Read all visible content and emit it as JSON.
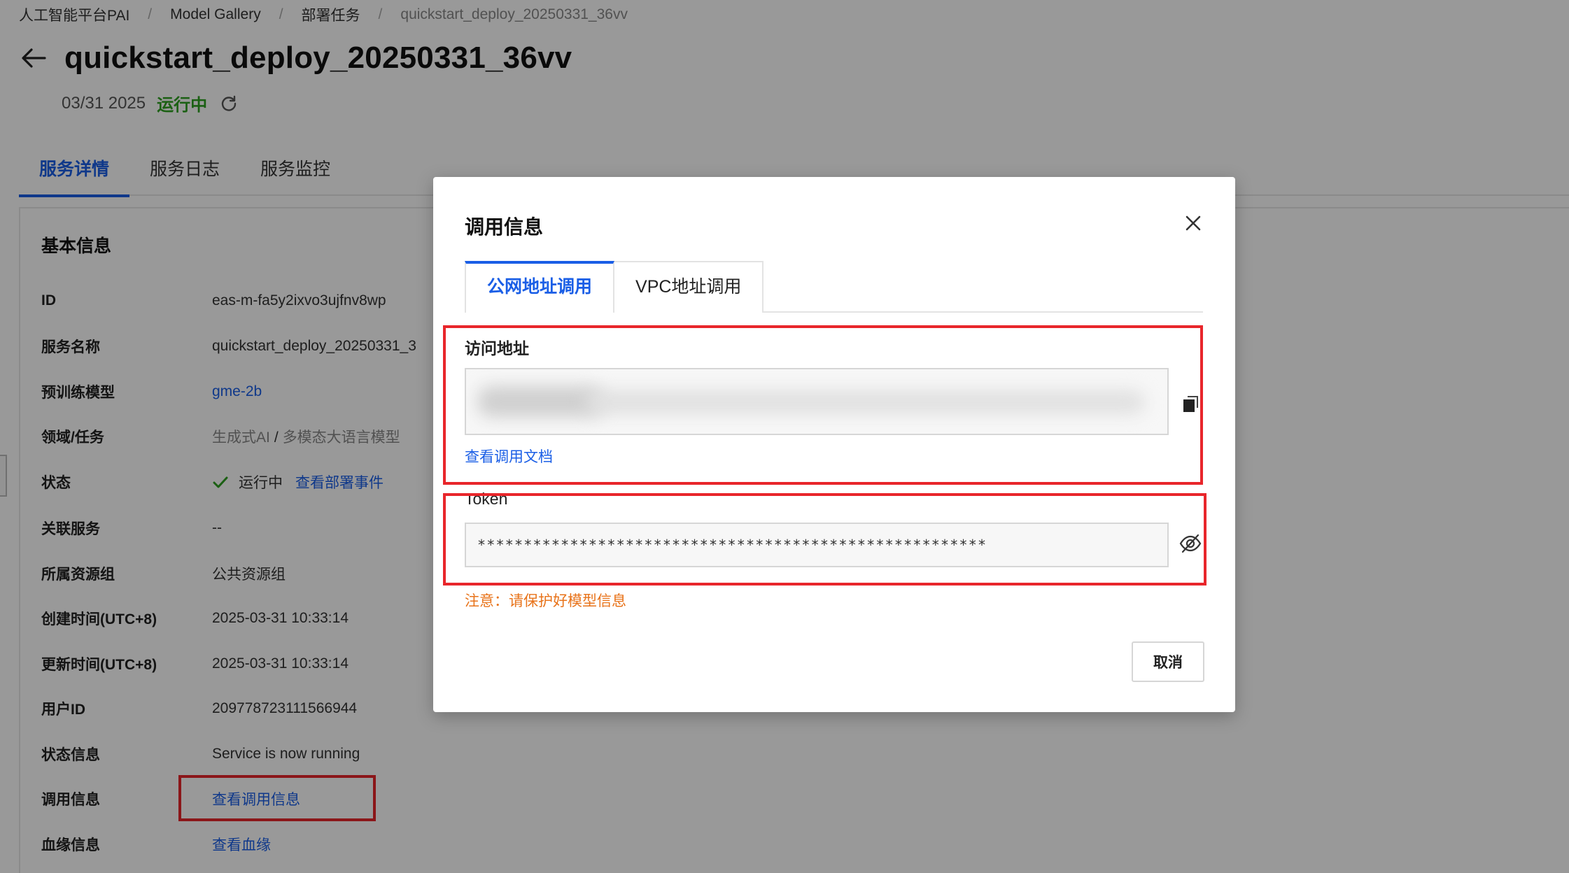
{
  "breadcrumb": {
    "items": [
      "人工智能平台PAI",
      "Model Gallery",
      "部署任务",
      "quickstart_deploy_20250331_36vv"
    ],
    "separator": "/"
  },
  "header": {
    "title": "quickstart_deploy_20250331_36vv",
    "date": "03/31 2025",
    "status": "运行中"
  },
  "tabs": [
    {
      "label": "服务详情",
      "active": true
    },
    {
      "label": "服务日志",
      "active": false
    },
    {
      "label": "服务监控",
      "active": false
    }
  ],
  "basic_info": {
    "title": "基本信息",
    "rows": {
      "id": {
        "label": "ID",
        "value": "eas-m-fa5y2ixvo3ujfnv8wp"
      },
      "service_name": {
        "label": "服务名称",
        "value": "quickstart_deploy_20250331_3"
      },
      "model": {
        "label": "预训练模型",
        "value": "gme-2b"
      },
      "domain": {
        "label": "领域/任务",
        "value_a": "生成式AI",
        "sep": "/",
        "value_b": "多模态大语言模型"
      },
      "status": {
        "label": "状态",
        "value": "运行中",
        "link": "查看部署事件"
      },
      "related": {
        "label": "关联服务",
        "value": "--"
      },
      "resource_group": {
        "label": "所属资源组",
        "value": "公共资源组"
      },
      "created": {
        "label": "创建时间(UTC+8)",
        "value": "2025-03-31 10:33:14"
      },
      "updated": {
        "label": "更新时间(UTC+8)",
        "value": "2025-03-31 10:33:14"
      },
      "user_id": {
        "label": "用户ID",
        "value": "209778723111566944"
      },
      "status_info": {
        "label": "状态信息",
        "value": "Service is now running"
      },
      "invoke_info": {
        "label": "调用信息",
        "value": "查看调用信息"
      },
      "lineage": {
        "label": "血缘信息",
        "value": "查看血缘"
      }
    }
  },
  "modal": {
    "title": "调用信息",
    "tabs": [
      {
        "label": "公网地址调用",
        "active": true
      },
      {
        "label": "VPC地址调用",
        "active": false
      }
    ],
    "endpoint_label": "访问地址",
    "doc_link": "查看调用文档",
    "token_label": "Token",
    "token_value": "*******************************************************",
    "warning": "注意：请保护好模型信息",
    "cancel_label": "取消"
  },
  "colors": {
    "accent": "#1a5ee6",
    "running_green": "#2ea121",
    "warning_orange": "#e8731a",
    "highlight_red": "#e8262b"
  },
  "icons": [
    "back-arrow-icon",
    "refresh-icon",
    "check-icon",
    "close-icon",
    "copy-icon",
    "eye-off-icon"
  ]
}
